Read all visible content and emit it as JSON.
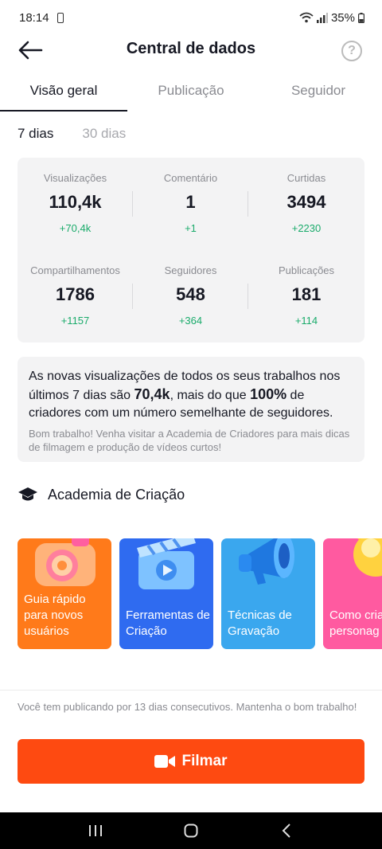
{
  "status_bar": {
    "time": "18:14",
    "battery": "35%"
  },
  "header": {
    "title": "Central de dados",
    "help_symbol": "?"
  },
  "tabs": [
    {
      "label": "Visão geral",
      "active": true
    },
    {
      "label": "Publicação",
      "active": false
    },
    {
      "label": "Seguidor",
      "active": false
    }
  ],
  "range": [
    {
      "label": "7 dias",
      "active": true
    },
    {
      "label": "30 dias",
      "active": false
    }
  ],
  "stats": [
    {
      "label": "Visualizações",
      "value": "110,4k",
      "delta": "+70,4k"
    },
    {
      "label": "Comentário",
      "value": "1",
      "delta": "+1"
    },
    {
      "label": "Curtidas",
      "value": "3494",
      "delta": "+2230"
    },
    {
      "label": "Compartilhamentos",
      "value": "1786",
      "delta": "+1157"
    },
    {
      "label": "Seguidores",
      "value": "548",
      "delta": "+364"
    },
    {
      "label": "Publicações",
      "value": "181",
      "delta": "+114"
    }
  ],
  "insight": {
    "part1": "As novas visualizações de todos os seus trabalhos nos últimos 7 dias são ",
    "highlight1": "70,4k",
    "part2": ", mais do que ",
    "highlight2": "100%",
    "part3": " de criadores com um número semelhante de seguidores.",
    "sub": "Bom trabalho! Venha visitar a Academia de Criadores para mais dicas de filmagem e produção de vídeos curtos!"
  },
  "academy": {
    "title": "Academia de Criação",
    "cards": [
      {
        "label": "Guia rápido para novos usuários",
        "icon": "camera-illustration",
        "color": "#ff7a1a"
      },
      {
        "label": "Ferramentas de Criação",
        "icon": "clapperboard-illustration",
        "color": "#2f6bf0"
      },
      {
        "label": "Técnicas de Gravação",
        "icon": "megaphone-illustration",
        "color": "#3aa7ee"
      },
      {
        "label": "Como criar personag",
        "icon": "bulb-illustration",
        "color": "#ff5aa0"
      }
    ]
  },
  "footer": {
    "streak": "Você tem publicando por 13 dias consecutivos. Mantenha o bom trabalho!",
    "record_label": "Filmar"
  },
  "colors": {
    "accent": "#fe4a11",
    "positive": "#1aab6b"
  }
}
